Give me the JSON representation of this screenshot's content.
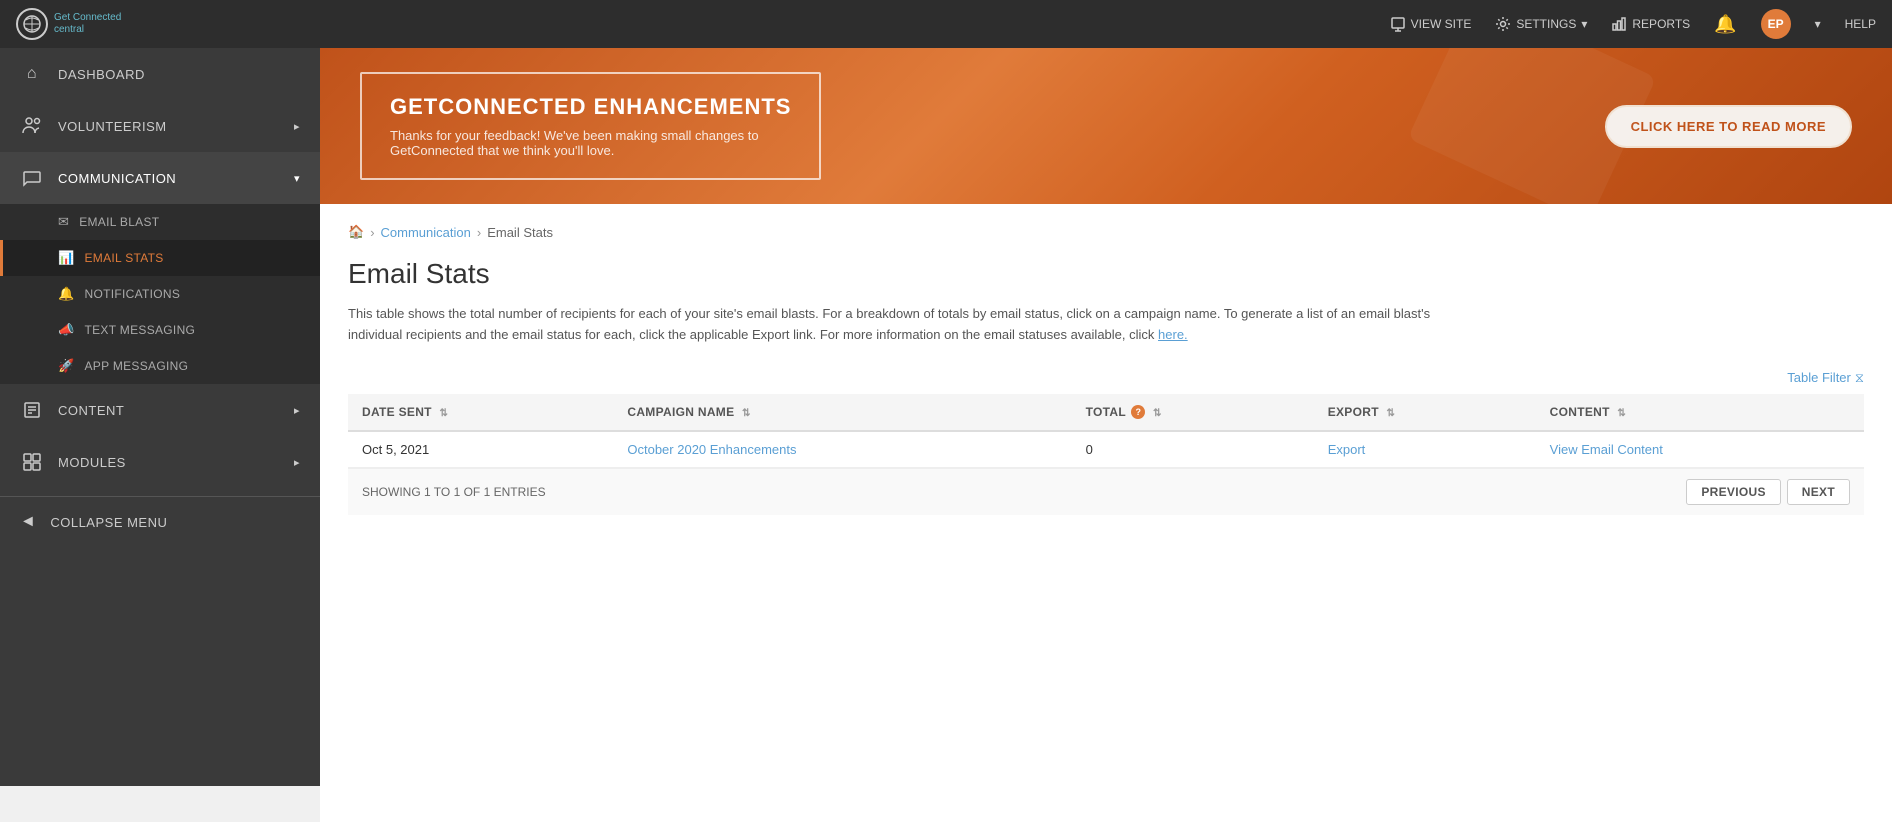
{
  "app": {
    "logo_x": "X",
    "logo_name": "Get Connected",
    "logo_sub": "central"
  },
  "topnav": {
    "view_site": "VIEW SITE",
    "settings": "SETTINGS",
    "reports": "REPORTS",
    "help": "HELP",
    "user_initials": "EP"
  },
  "sidebar": {
    "dashboard_label": "DASHBOARD",
    "volunteerism_label": "VOLUNTEERISM",
    "communication_label": "COMMUNICATION",
    "email_blast_label": "EMAIL BLAST",
    "email_stats_label": "EMAIL STATS",
    "notifications_label": "NOTIFICATIONS",
    "text_messaging_label": "TEXT MESSAGING",
    "app_messaging_label": "APP MESSAGING",
    "content_label": "CONTENT",
    "modules_label": "MODULES",
    "collapse_label": "COLLAPSE MENU"
  },
  "banner": {
    "title": "GETCONNECTED ENHANCEMENTS",
    "subtitle": "Thanks for your feedback! We've been making small changes to\nGetConnected that we think you'll love.",
    "button": "CLICK HERE TO READ MORE"
  },
  "breadcrumb": {
    "home_title": "Home",
    "communication": "Communication",
    "current": "Email Stats"
  },
  "page": {
    "title": "Email Stats",
    "description": "This table shows the total number of recipients for each of your site's email blasts. For a breakdown of totals by email status, click on a campaign name. To generate a list of an email blast's individual recipients and the email status for each, click the applicable Export link. For more information on the email statuses available, click",
    "desc_link": "here.",
    "table_filter": "Table Filter"
  },
  "table": {
    "columns": [
      {
        "key": "date_sent",
        "label": "DATE SENT"
      },
      {
        "key": "campaign_name",
        "label": "CAMPAIGN NAME"
      },
      {
        "key": "total",
        "label": "TOTAL"
      },
      {
        "key": "export",
        "label": "EXPORT"
      },
      {
        "key": "content",
        "label": "CONTENT"
      }
    ],
    "rows": [
      {
        "date_sent": "Oct 5, 2021",
        "campaign_name": "October 2020 Enhancements",
        "campaign_link": "#",
        "total": "0",
        "export": "Export",
        "export_link": "#",
        "content": "View Email Content",
        "content_link": "#"
      }
    ],
    "showing": "SHOWING 1 TO 1 OF 1 ENTRIES",
    "previous_btn": "PREVIOUS",
    "next_btn": "NEXT"
  }
}
